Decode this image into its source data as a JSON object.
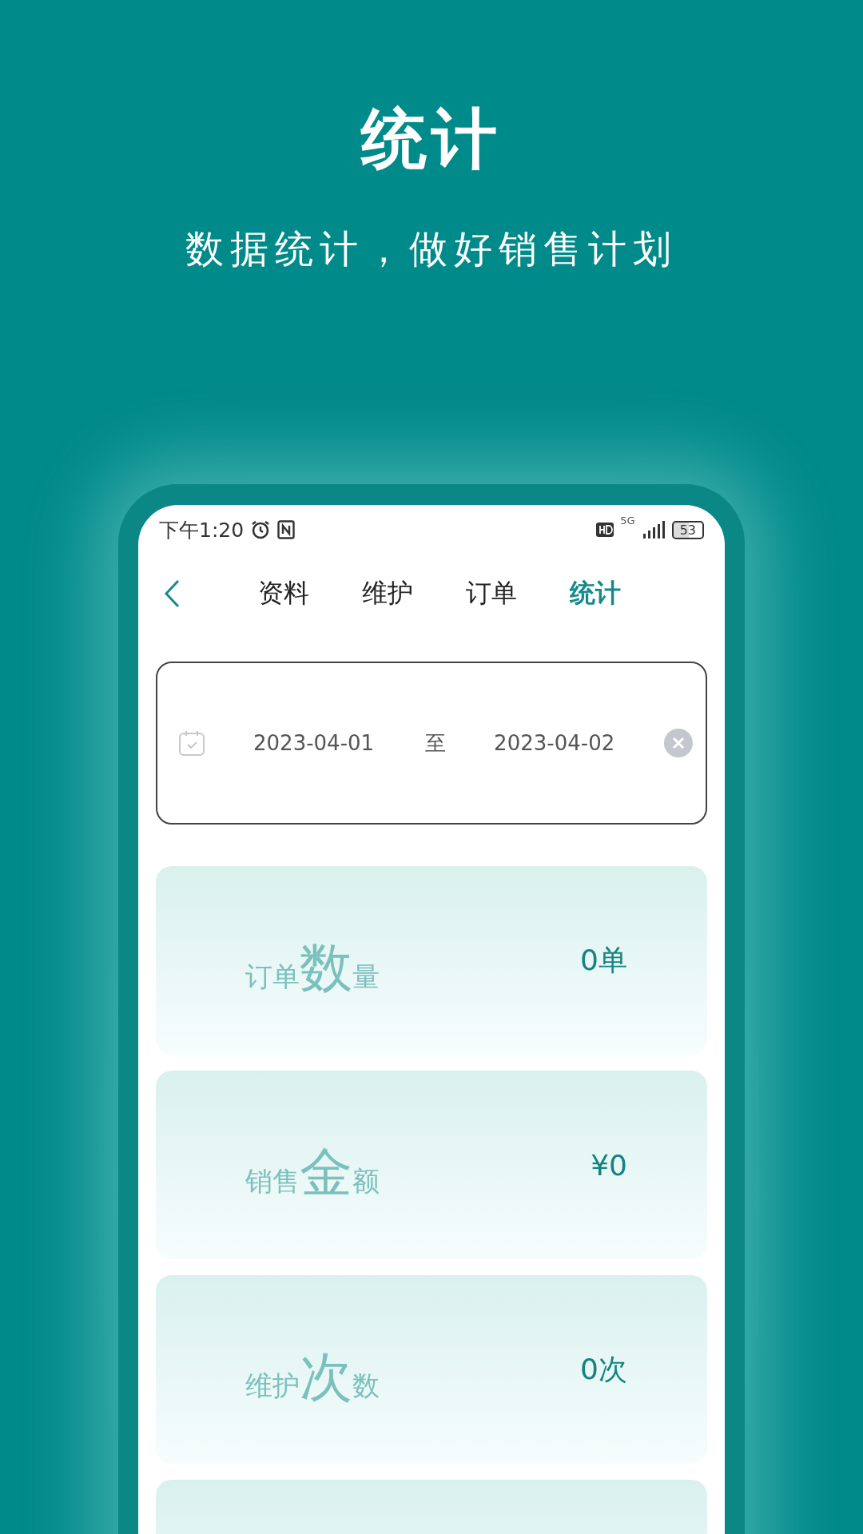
{
  "promo": {
    "title": "统计",
    "subtitle": "数据统计，做好销售计划"
  },
  "status_bar": {
    "time": "下午1:20",
    "network": "5G",
    "battery": "53"
  },
  "tabs": [
    {
      "label": "资料",
      "selected": false
    },
    {
      "label": "维护",
      "selected": false
    },
    {
      "label": "订单",
      "selected": false
    },
    {
      "label": "统计",
      "selected": true
    }
  ],
  "date_range": {
    "start": "2023-04-01",
    "separator": "至",
    "end": "2023-04-02"
  },
  "cards": [
    {
      "label": "订单**数**量",
      "value": "0单"
    },
    {
      "label": "销售**金**额",
      "value": "¥0"
    },
    {
      "label": "维护**次**数",
      "value": "0次"
    }
  ]
}
